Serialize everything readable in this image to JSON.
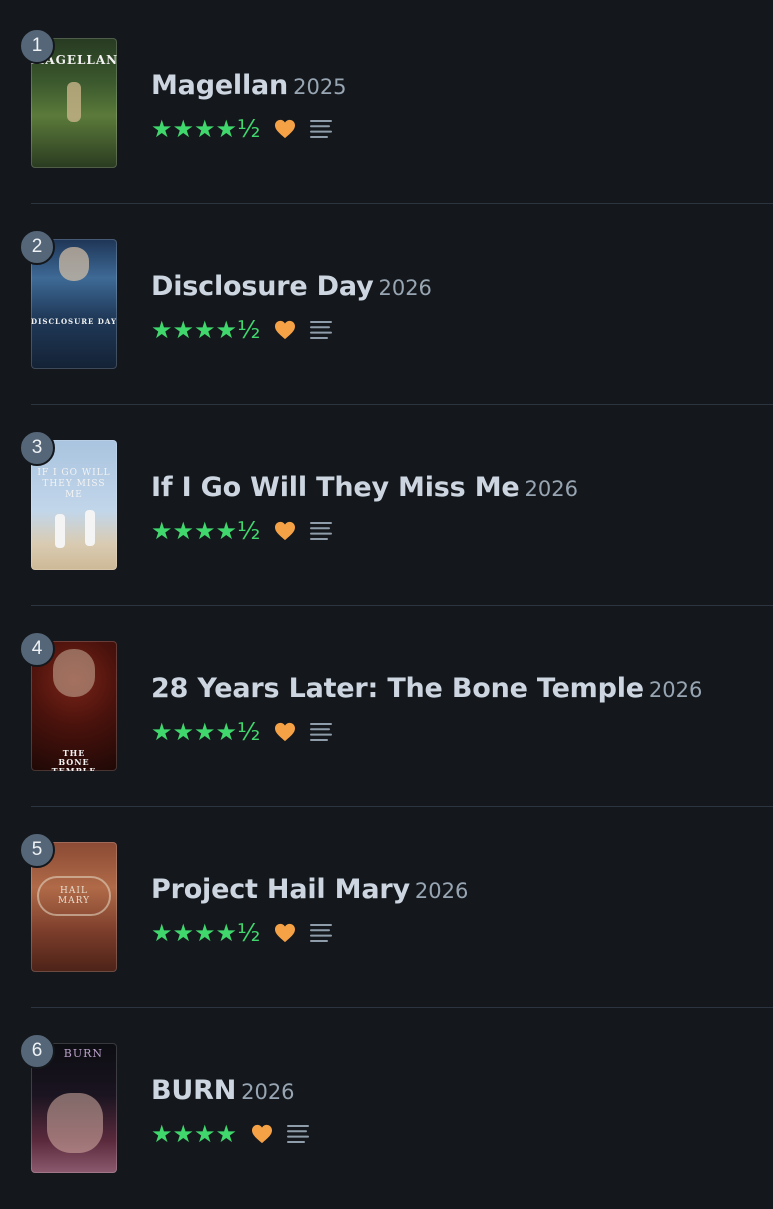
{
  "films": [
    {
      "rank": "1",
      "title": "Magellan",
      "year": "2025",
      "stars": "★★★★½",
      "poster_text": "MAGELLAN"
    },
    {
      "rank": "2",
      "title": "Disclosure Day",
      "year": "2026",
      "stars": "★★★★½",
      "poster_text": "DISCLOSURE DAY"
    },
    {
      "rank": "3",
      "title": "If I Go Will They Miss Me",
      "year": "2026",
      "stars": "★★★★½",
      "poster_text": "IF I GO WILL THEY MISS ME"
    },
    {
      "rank": "4",
      "title": "28 Years Later: The Bone Temple",
      "year": "2026",
      "stars": "★★★★½",
      "poster_text": "THE BONE TEMPLE"
    },
    {
      "rank": "5",
      "title": "Project Hail Mary",
      "year": "2026",
      "stars": "★★★★½",
      "poster_text": "HAIL MARY"
    },
    {
      "rank": "6",
      "title": "BURN",
      "year": "2026",
      "stars": "★★★★",
      "poster_text": "BURN"
    }
  ],
  "icons": {
    "heart": "heart-icon",
    "review": "review-lines-icon"
  },
  "colors": {
    "background": "#14181c",
    "star": "#40d76d",
    "heart": "#f5a246",
    "rank_badge": "#556678"
  }
}
